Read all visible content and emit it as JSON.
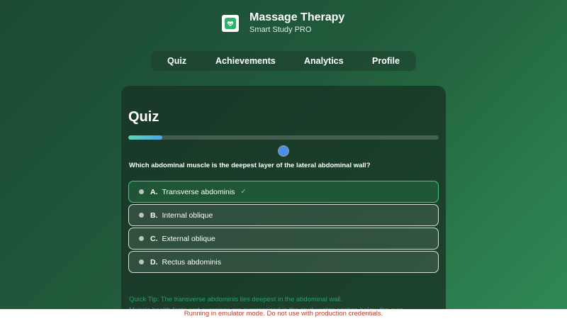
{
  "header": {
    "app_title": "Massage Therapy",
    "app_subtitle": "Smart Study PRO",
    "icon": "app-logo-icon"
  },
  "nav": {
    "items": [
      {
        "label": "Quiz"
      },
      {
        "label": "Achievements"
      },
      {
        "label": "Analytics"
      },
      {
        "label": "Profile"
      }
    ]
  },
  "quiz": {
    "heading": "Quiz",
    "progress_fraction": 0.11,
    "question": "Which abdominal muscle is the deepest layer of the lateral abdominal wall?",
    "options": [
      {
        "letter": "A.",
        "text": "Transverse abdominis",
        "mark": "✓",
        "state": "correct"
      },
      {
        "letter": "B.",
        "text": "Internal oblique"
      },
      {
        "letter": "C.",
        "text": "External oblique"
      },
      {
        "letter": "D.",
        "text": "Rectus abdominis"
      }
    ],
    "tip": "Quick Tip: The transverse abdominis lies deepest in the abdominal wall.",
    "tip_extra": "Muscle health facts and exercises are summarized in the study notes section below the quiz."
  },
  "banner": {
    "text": "Running in emulator mode. Do not use with production credentials."
  },
  "colors": {
    "accent_green": "#46c774",
    "progress_dot": "#4a8fe8",
    "banner_text": "#c0392b"
  }
}
